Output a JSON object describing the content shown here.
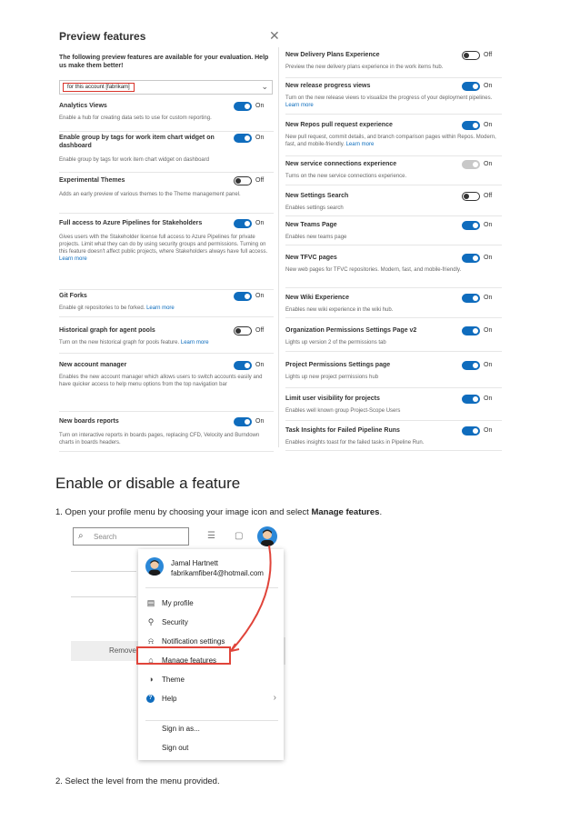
{
  "panel": {
    "title": "Preview features",
    "close_glyph": "✕",
    "description": "The following preview features are available for your evaluation. Help us make them better!",
    "dropdown_value": "for this account [fabrikam]",
    "highlight_color": "#d9342b",
    "accent_color": "#0f6cbd",
    "left_features": [
      {
        "name": "Analytics Views",
        "desc": "Enable a hub for creating data sets to use for custom reporting.",
        "link": "",
        "state": "On",
        "toggle": "on"
      },
      {
        "name": "Enable group by tags for work item chart widget on dashboard",
        "desc": "Enable group by tags for work item chart widget on dashboard",
        "link": "",
        "state": "On",
        "toggle": "on"
      },
      {
        "name": "Experimental Themes",
        "desc": "Adds an early preview of various themes to the Theme management panel.",
        "link": "",
        "state": "Off",
        "toggle": "off"
      },
      {
        "name": "Full access to Azure Pipelines for Stakeholders",
        "desc": "Gives users with the Stakeholder license full access to Azure Pipelines for private projects. Limit what they can do by using security groups and permissions. Turning on this feature doesn't affect public projects, where Stakeholders always have full access.",
        "link": "Learn more",
        "state": "On",
        "toggle": "on"
      },
      {
        "name": "Git Forks",
        "desc": "Enable git repositories to be forked.",
        "link": "Learn more",
        "state": "On",
        "toggle": "on"
      },
      {
        "name": "Historical graph for agent pools",
        "desc": "Turn on the new historical graph for pools feature.",
        "link": "Learn more",
        "state": "Off",
        "toggle": "off"
      },
      {
        "name": "New account manager",
        "desc": "Enables the new account manager which allows users to switch accounts easily and have quicker access to help menu options from the top navigation bar",
        "link": "",
        "state": "On",
        "toggle": "on"
      },
      {
        "name": "New boards reports",
        "desc": "Turn on interactive reports in boards pages, replacing CFD, Velocity and Burndown charts in boards headers.",
        "link": "",
        "state": "On",
        "toggle": "on"
      }
    ],
    "right_features": [
      {
        "name": "New Delivery Plans Experience",
        "desc": "Preview the new delivery plans experience in the work items hub.",
        "link": "",
        "state": "Off",
        "toggle": "off"
      },
      {
        "name": "New release progress views",
        "desc": "Turn on the new release views to visualize the progress of your deployment pipelines.",
        "link": "Learn more",
        "state": "On",
        "toggle": "on"
      },
      {
        "name": "New Repos pull request experience",
        "desc": "New pull request, commit details, and branch comparison pages within Repos. Modern, fast, and mobile-friendly.",
        "link": "Learn more",
        "state": "On",
        "toggle": "on"
      },
      {
        "name": "New service connections experience",
        "desc": "Turns on the new service connections experience.",
        "link": "",
        "state": "On",
        "toggle": "dis"
      },
      {
        "name": "New Settings Search",
        "desc": "Enables settings search",
        "link": "",
        "state": "Off",
        "toggle": "off"
      },
      {
        "name": "New Teams Page",
        "desc": "Enables new teams page",
        "link": "",
        "state": "On",
        "toggle": "on"
      },
      {
        "name": "New TFVC pages",
        "desc": "New web pages for TFVC repositories. Modern, fast, and mobile-friendly.",
        "link": "",
        "state": "On",
        "toggle": "on"
      },
      {
        "name": "New Wiki Experience",
        "desc": "Enables new wiki experience in the wiki hub.",
        "link": "",
        "state": "On",
        "toggle": "on"
      },
      {
        "name": "Organization Permissions Settings Page v2",
        "desc": "Lights up version 2 of the permissions tab",
        "link": "",
        "state": "On",
        "toggle": "on"
      },
      {
        "name": "Project Permissions Settings page",
        "desc": "Lights up new project permissions hub",
        "link": "",
        "state": "On",
        "toggle": "on"
      },
      {
        "name": "Limit user visibility for projects",
        "desc": "Enables well known group Project-Scope Users",
        "link": "",
        "state": "On",
        "toggle": "on"
      },
      {
        "name": "Task Insights for Failed Pipeline Runs",
        "desc": "Enables insights toast for the failed tasks in Pipeline Run.",
        "link": "",
        "state": "On",
        "toggle": "on"
      }
    ]
  },
  "doc": {
    "heading": "Enable or disable a feature",
    "step1_prefix": "1.  Open your profile menu by choosing your image icon and select ",
    "step1_bold": "Manage features",
    "step1_suffix": ".",
    "step2": "2.  Select the level from the menu provided."
  },
  "profile_shot": {
    "search_placeholder": "Search",
    "remove_label": "Remove",
    "user_name": "Jamal Hartnett",
    "user_email": "fabrikamfiber4@hotmail.com",
    "items": [
      {
        "label": "My profile",
        "icon": "profile-card-icon",
        "glyph": "▤"
      },
      {
        "label": "Security",
        "icon": "key-icon",
        "glyph": "⚲"
      },
      {
        "label": "Notification settings",
        "icon": "bell-icon",
        "glyph": "⍾"
      },
      {
        "label": "Manage features",
        "icon": "manage-features-icon",
        "glyph": "⌂"
      },
      {
        "label": "Theme",
        "icon": "theme-icon",
        "glyph": "◑"
      },
      {
        "label": "Help",
        "icon": "help-icon",
        "glyph": "?"
      }
    ],
    "help_chevron": "›",
    "sign_in_as": "Sign in as...",
    "sign_out": "Sign out",
    "arrow_color": "#e0443a"
  }
}
